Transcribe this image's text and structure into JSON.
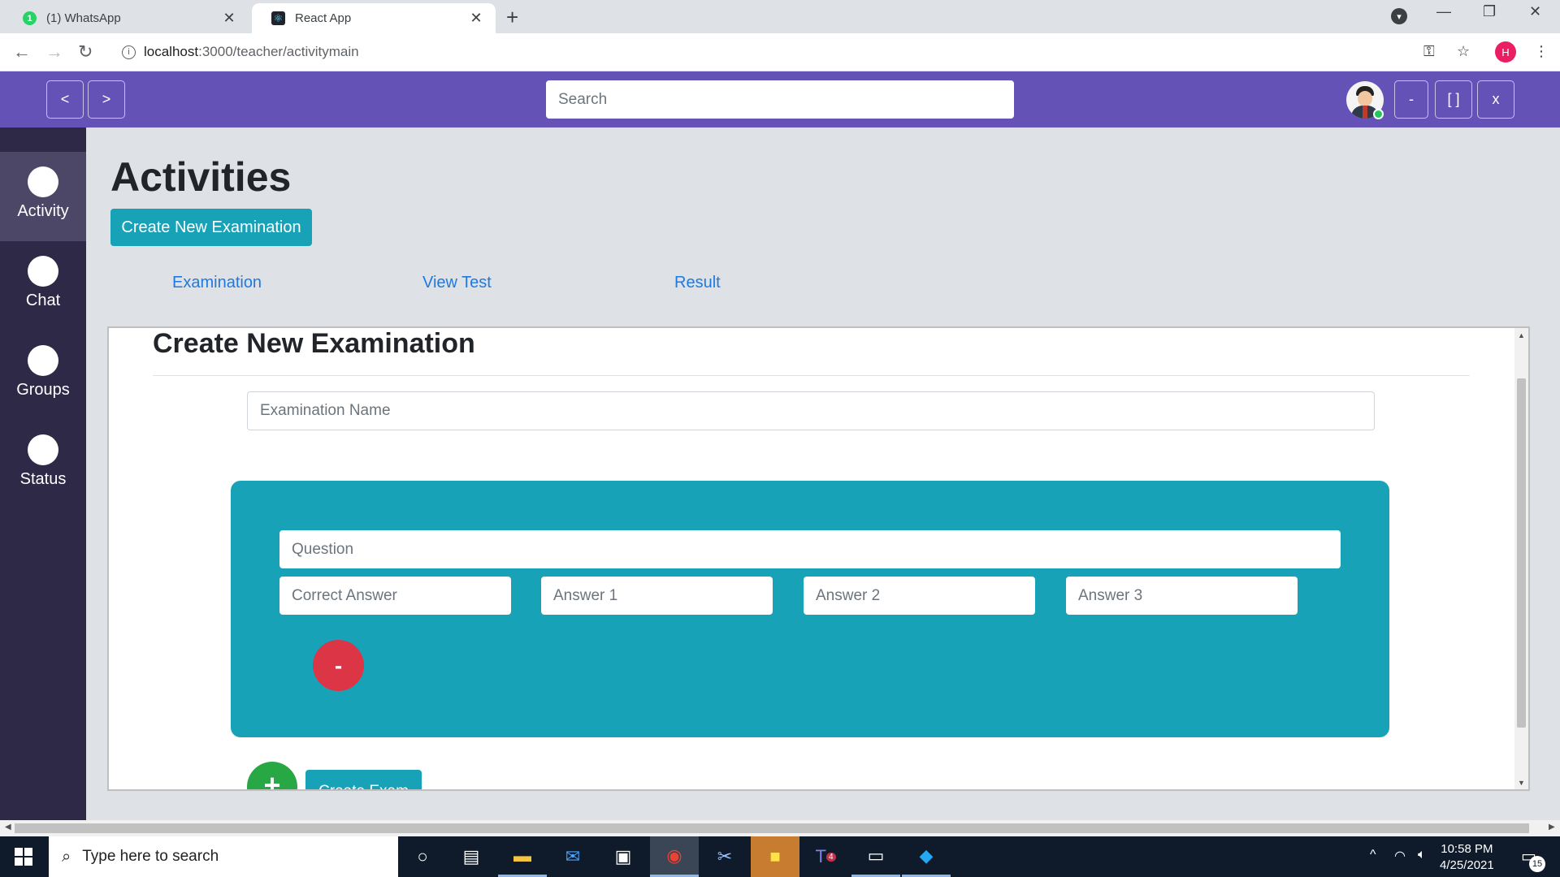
{
  "browser": {
    "tabs": [
      {
        "title": "(1) WhatsApp",
        "badge": "1",
        "active": false
      },
      {
        "title": "React App",
        "active": true
      }
    ],
    "new_tab": "+",
    "url_host": "localhost",
    "url_path": ":3000/teacher/activitymain",
    "profile_initial": "H",
    "window_controls": {
      "minimize": "—",
      "restore": "❐",
      "close": "✕"
    }
  },
  "header": {
    "back_label": "<",
    "forward_label": ">",
    "search_placeholder": "Search",
    "minimize_label": "-",
    "maximize_label": "[ ]",
    "close_label": "x"
  },
  "sidebar": {
    "items": [
      {
        "label": "Activity",
        "active": true
      },
      {
        "label": "Chat",
        "active": false
      },
      {
        "label": "Groups",
        "active": false
      },
      {
        "label": "Status",
        "active": false
      }
    ]
  },
  "main": {
    "title": "Activities",
    "create_button": "Create New Examination",
    "nav_links": [
      "Examination",
      "View Test",
      "Result"
    ]
  },
  "form": {
    "title": "Create New Examination",
    "exam_name_placeholder": "Examination Name",
    "question_placeholder": "Question",
    "answer_placeholders": [
      "Correct Answer",
      "Answer 1",
      "Answer 2",
      "Answer 3"
    ],
    "remove_label": "-",
    "add_label": "+",
    "submit_label": "Create Exam"
  },
  "taskbar": {
    "search_placeholder": "Type here to search",
    "time": "10:58 PM",
    "date": "4/25/2021",
    "notification_count": "15",
    "teams_badge": "4"
  },
  "colors": {
    "header_bg": "#6552b7",
    "sidebar_bg": "#2e2947",
    "accent_teal": "#17a2b8",
    "danger": "#dc3545",
    "success": "#28a745",
    "link": "#1e7adf"
  }
}
